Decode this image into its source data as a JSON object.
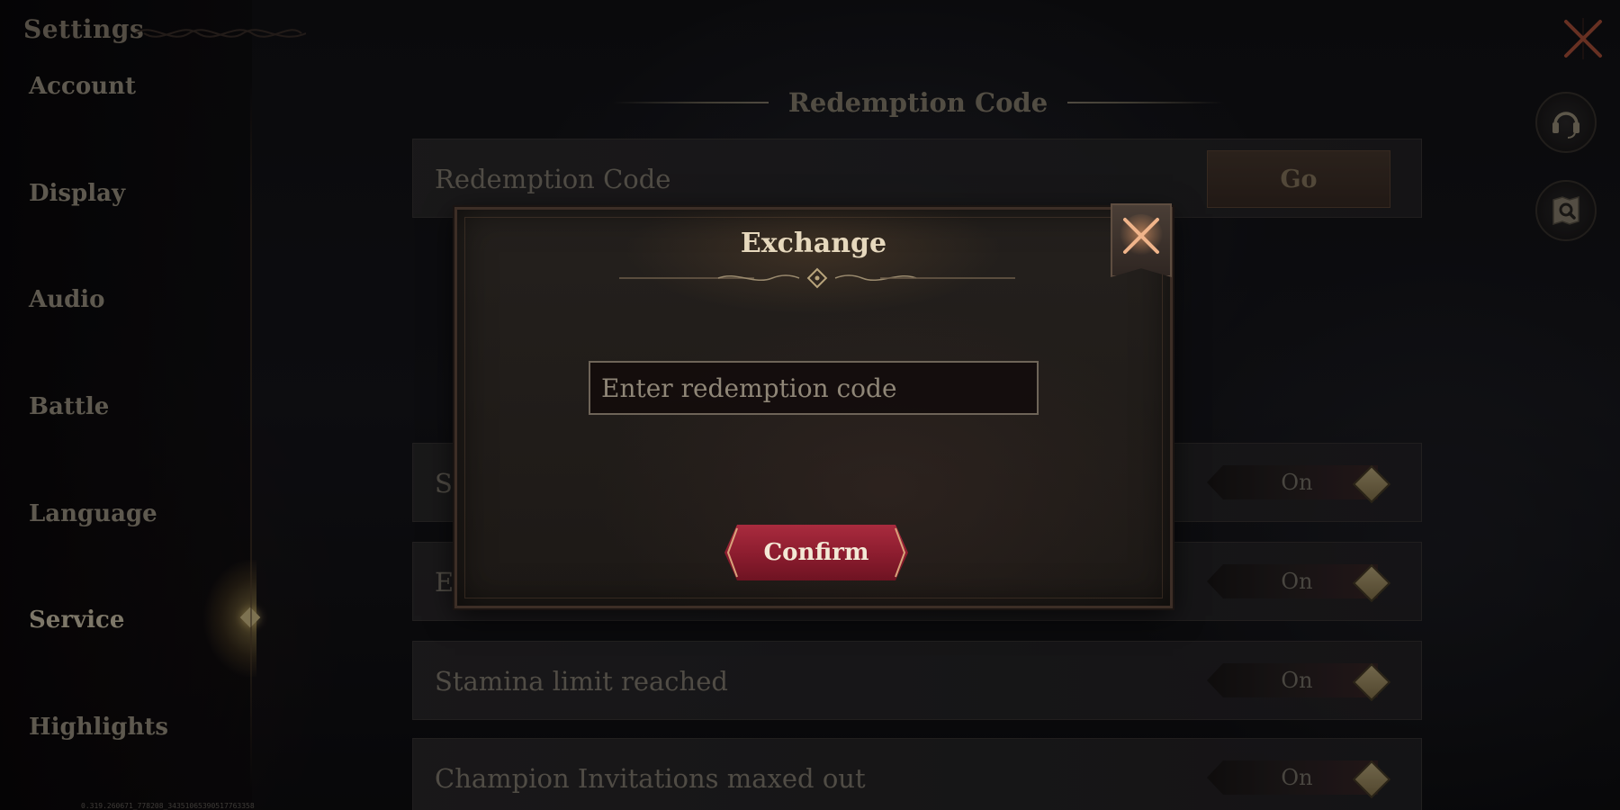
{
  "sidebar": {
    "title": "Settings",
    "items": [
      {
        "label": "Account"
      },
      {
        "label": "Display"
      },
      {
        "label": "Audio"
      },
      {
        "label": "Battle"
      },
      {
        "label": "Language"
      },
      {
        "label": "Service"
      },
      {
        "label": "Highlights"
      }
    ],
    "active": "Service"
  },
  "content": {
    "section_title": "Redemption Code",
    "redemption_row": {
      "label": "Redemption Code",
      "button": "Go"
    },
    "toggle_rows": [
      {
        "label": "S",
        "value": "On"
      },
      {
        "label": "E",
        "value": "On"
      },
      {
        "label": "Stamina limit reached",
        "value": "On"
      },
      {
        "label": "Champion Invitations maxed out",
        "value": "On"
      }
    ]
  },
  "modal": {
    "title": "Exchange",
    "input_value": "",
    "input_placeholder": "Enter redemption code",
    "confirm_label": "Confirm"
  },
  "icons": {
    "close": "close-icon",
    "support": "headset-icon",
    "guide": "map-search-icon",
    "modal_close": "close-icon"
  },
  "footer": {
    "build_id": "0.319.260671_778208_34351065390517763358"
  },
  "colors": {
    "accent_gold": "#d7c48c",
    "confirm_red": "#8b1c2e",
    "modal_close_x": "#e89a6a"
  }
}
